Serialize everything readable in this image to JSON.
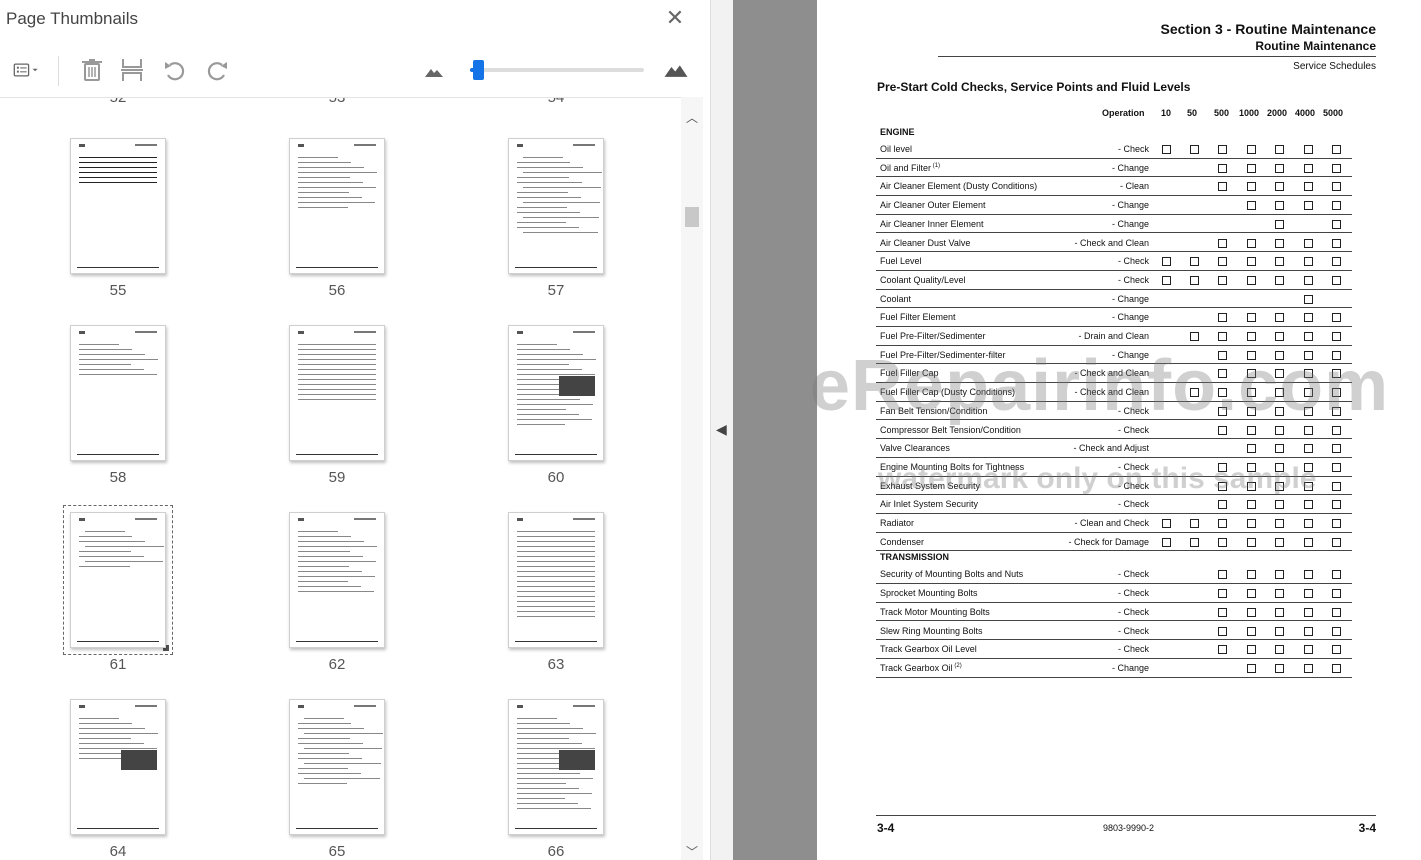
{
  "panel": {
    "title": "Page Thumbnails",
    "close_icon": "close-icon",
    "toolbar": {
      "options_icon": "thumbnail-options-icon",
      "delete_icon": "trash-icon",
      "insert_icon": "insert-page-icon",
      "rotate_ccw_icon": "rotate-counterclockwise-icon",
      "rotate_cw_icon": "rotate-clockwise-icon",
      "zoom_out_icon": "small-mountain-icon",
      "zoom_in_icon": "large-mountain-icon",
      "zoom_level": 0.03
    },
    "partial_labels": [
      "52",
      "53",
      "54"
    ],
    "thumbnails": [
      "55",
      "56",
      "57",
      "58",
      "59",
      "60",
      "61",
      "62",
      "63",
      "64",
      "65",
      "66"
    ],
    "selected": "61"
  },
  "document": {
    "section_title": "Section 3 - Routine Maintenance",
    "section_subtitle": "Routine Maintenance",
    "section_schedule": "Service Schedules",
    "heading": "Pre-Start Cold Checks, Service Points and Fluid Levels",
    "columns": [
      "Operation",
      "10",
      "50",
      "500",
      "1000",
      "2000",
      "4000",
      "5000"
    ],
    "sections": [
      {
        "name": "ENGINE",
        "rows": [
          {
            "item": "Oil level",
            "op": "- Check",
            "checks": [
              1,
              1,
              1,
              1,
              1,
              1,
              1
            ]
          },
          {
            "item": "Oil and Filter",
            "sup": "(1)",
            "op": "- Change",
            "checks": [
              0,
              0,
              1,
              1,
              1,
              1,
              1
            ]
          },
          {
            "item": "Air Cleaner Element (Dusty Conditions)",
            "op": "- Clean",
            "checks": [
              0,
              0,
              1,
              1,
              1,
              1,
              1
            ]
          },
          {
            "item": "Air Cleaner Outer Element",
            "op": "- Change",
            "checks": [
              0,
              0,
              0,
              1,
              1,
              1,
              1
            ]
          },
          {
            "item": "Air Cleaner Inner Element",
            "op": "- Change",
            "checks": [
              0,
              0,
              0,
              0,
              1,
              0,
              1
            ]
          },
          {
            "item": "Air Cleaner Dust Valve",
            "op": "- Check and Clean",
            "checks": [
              0,
              0,
              1,
              1,
              1,
              1,
              1
            ]
          },
          {
            "item": "Fuel Level",
            "op": "- Check",
            "checks": [
              1,
              1,
              1,
              1,
              1,
              1,
              1
            ]
          },
          {
            "item": "Coolant Quality/Level",
            "op": "- Check",
            "checks": [
              1,
              1,
              1,
              1,
              1,
              1,
              1
            ]
          },
          {
            "item": "Coolant",
            "op": "- Change",
            "checks": [
              0,
              0,
              0,
              0,
              0,
              1,
              0
            ]
          },
          {
            "item": "Fuel Filter Element",
            "op": "- Change",
            "checks": [
              0,
              0,
              1,
              1,
              1,
              1,
              1
            ]
          },
          {
            "item": "Fuel Pre-Filter/Sedimenter",
            "op": "- Drain and Clean",
            "checks": [
              0,
              1,
              1,
              1,
              1,
              1,
              1
            ]
          },
          {
            "item": "Fuel Pre-Filter/Sedimenter-filter",
            "op": "- Change",
            "checks": [
              0,
              0,
              1,
              1,
              1,
              1,
              1
            ]
          },
          {
            "item": "Fuel Filler Cap",
            "op": "- Check and Clean",
            "checks": [
              0,
              0,
              1,
              1,
              1,
              1,
              1
            ]
          },
          {
            "item": "Fuel Filler Cap (Dusty Conditions)",
            "op": "- Check and Clean",
            "checks": [
              0,
              1,
              1,
              1,
              1,
              1,
              1
            ]
          },
          {
            "item": "Fan Belt Tension/Condition",
            "op": "- Check",
            "checks": [
              0,
              0,
              1,
              1,
              1,
              1,
              1
            ]
          },
          {
            "item": "Compressor Belt Tension/Condition",
            "op": "- Check",
            "checks": [
              0,
              0,
              1,
              1,
              1,
              1,
              1
            ]
          },
          {
            "item": "Valve Clearances",
            "op": "- Check and Adjust",
            "checks": [
              0,
              0,
              0,
              1,
              1,
              1,
              1
            ]
          },
          {
            "item": "Engine Mounting Bolts for Tightness",
            "op": "- Check",
            "checks": [
              0,
              0,
              1,
              1,
              1,
              1,
              1
            ]
          },
          {
            "item": "Exhaust System Security",
            "op": "- Check",
            "checks": [
              0,
              0,
              1,
              1,
              1,
              1,
              1
            ]
          },
          {
            "item": "Air Inlet System Security",
            "op": "- Check",
            "checks": [
              0,
              0,
              1,
              1,
              1,
              1,
              1
            ]
          },
          {
            "item": "Radiator",
            "op": "- Clean and Check",
            "checks": [
              1,
              1,
              1,
              1,
              1,
              1,
              1
            ]
          },
          {
            "item": "Condenser",
            "op": "- Check for Damage",
            "checks": [
              1,
              1,
              1,
              1,
              1,
              1,
              1
            ]
          }
        ]
      },
      {
        "name": "TRANSMISSION",
        "rows": [
          {
            "item": "Security of Mounting Bolts and Nuts",
            "op": "- Check",
            "checks": [
              0,
              0,
              1,
              1,
              1,
              1,
              1
            ]
          },
          {
            "item": "Sprocket Mounting Bolts",
            "op": "- Check",
            "checks": [
              0,
              0,
              1,
              1,
              1,
              1,
              1
            ]
          },
          {
            "item": "Track Motor Mounting Bolts",
            "op": "- Check",
            "checks": [
              0,
              0,
              1,
              1,
              1,
              1,
              1
            ]
          },
          {
            "item": "Slew Ring Mounting Bolts",
            "op": "- Check",
            "checks": [
              0,
              0,
              1,
              1,
              1,
              1,
              1
            ]
          },
          {
            "item": "Track Gearbox Oil Level",
            "op": "- Check",
            "checks": [
              0,
              0,
              1,
              1,
              1,
              1,
              1
            ]
          },
          {
            "item": "Track Gearbox Oil",
            "sup": "(2)",
            "op": "- Change",
            "checks": [
              0,
              0,
              0,
              1,
              1,
              1,
              1
            ]
          }
        ]
      }
    ],
    "footer_left": "3-4",
    "footer_mid": "9803-9990-2",
    "footer_right": "3-4",
    "watermark": "eRepairinfo.com",
    "watermark_sub": "watermark only on this sample"
  }
}
